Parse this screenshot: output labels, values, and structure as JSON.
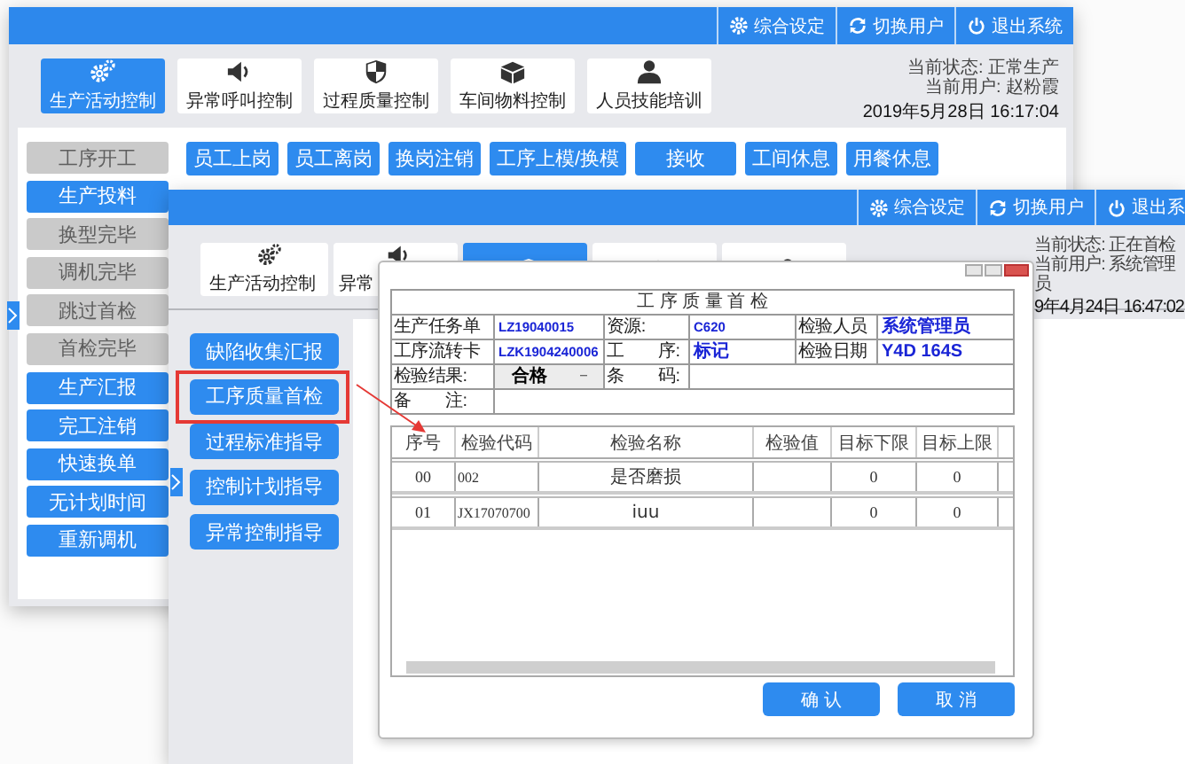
{
  "main_window": {
    "toolbar": [
      {
        "label": "综合设定"
      },
      {
        "label": "切换用户"
      },
      {
        "label": "退出系统"
      }
    ],
    "modules": [
      {
        "label": "生产活动控制",
        "selected": true
      },
      {
        "label": "异常呼叫控制",
        "selected": false
      },
      {
        "label": "过程质量控制",
        "selected": false
      },
      {
        "label": "车间物料控制",
        "selected": false
      },
      {
        "label": "人员技能培训",
        "selected": false
      }
    ],
    "status": [
      "当前状态: 正常生产",
      "当前用户: 赵粉霞"
    ],
    "datetime": "2019年5月28日  16:17:04",
    "sidebar": [
      {
        "label": "工序开工",
        "disabled": true
      },
      {
        "label": "生产投料",
        "disabled": false
      },
      {
        "label": "换型完毕",
        "disabled": true
      },
      {
        "label": "调机完毕",
        "disabled": true
      },
      {
        "label": "跳过首检",
        "disabled": true
      },
      {
        "label": "首检完毕",
        "disabled": true
      },
      {
        "label": "生产汇报",
        "disabled": false
      },
      {
        "label": "完工注销",
        "disabled": false
      },
      {
        "label": "快速换单",
        "disabled": false
      },
      {
        "label": "无计划时间",
        "disabled": false
      },
      {
        "label": "重新调机",
        "disabled": false
      }
    ],
    "actions": [
      "员工上岗",
      "员工离岗",
      "换岗注销",
      "工序上模/换模",
      "接收",
      "工间休息",
      "用餐休息"
    ]
  },
  "second_window": {
    "toolbar": [
      {
        "label": "综合设定"
      },
      {
        "label": "切换用户"
      },
      {
        "label": "退出系"
      }
    ],
    "modules": [
      {
        "label": "生产活动控制",
        "selected": false
      },
      {
        "label": "异常",
        "selected": false
      },
      {
        "selected": true
      },
      {
        "selected": false
      },
      {
        "selected": false
      }
    ],
    "status": [
      "当前状态: 正在首检",
      "当前用户: 系统管理员"
    ],
    "datetime": "9年4月24日  16:47:02",
    "sidebar": [
      {
        "label": "缺陷收集汇报",
        "highlighted": false
      },
      {
        "label": "工序质量首检",
        "highlighted": true
      },
      {
        "label": "过程标准指导",
        "highlighted": false
      },
      {
        "label": "控制计划指导",
        "highlighted": false
      },
      {
        "label": "异常控制指导",
        "highlighted": false
      }
    ]
  },
  "dialog": {
    "title": "工 序 质 量 首 检",
    "fields": [
      [
        {
          "label": "生产任务单",
          "value": "LZ19040015"
        },
        {
          "label": "资源:",
          "value": "C620"
        },
        {
          "label": "检验人员",
          "value": "系统管理员"
        }
      ],
      [
        {
          "label": "工序流转卡",
          "value": "LZK1904240006"
        },
        {
          "label": "工　　序:",
          "value": "标记"
        },
        {
          "label": "检验日期",
          "value": "Y4D 164S"
        }
      ]
    ],
    "result": {
      "label": "检验结果:",
      "value": "合格"
    },
    "barcode": {
      "label": "条　　码:"
    },
    "remark": {
      "label": "备　　注:"
    },
    "table": {
      "columns": [
        "序号",
        "检验代码",
        "检验名称",
        "检验值",
        "目标下限",
        "目标上限"
      ],
      "rows": [
        [
          "00",
          "002",
          "是否磨损",
          "",
          "0",
          "0"
        ],
        [
          "01",
          "JX17070700",
          "iuu",
          "",
          "0",
          "0"
        ]
      ]
    },
    "buttons": [
      "确 认",
      "取 消"
    ]
  }
}
